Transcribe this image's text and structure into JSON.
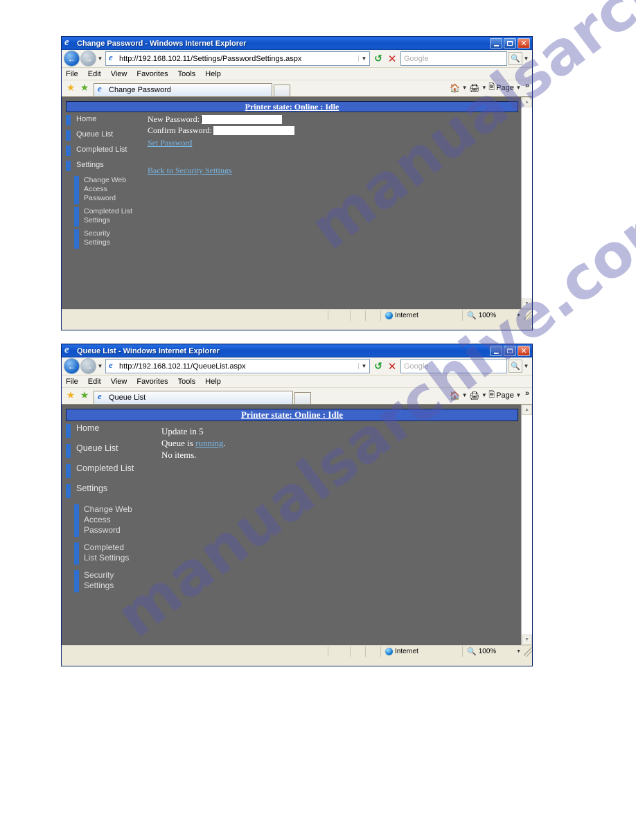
{
  "watermark": {
    "line1": "manualsarchive.com",
    "line2": "manualsarchive.com",
    "color": "#5656aa"
  },
  "windows": [
    {
      "id": "password",
      "titlebar": {
        "title": "Change Password - Windows Internet Explorer",
        "minimize_label": "Minimize",
        "maximize_label": "Maximize",
        "close_label": "Close"
      },
      "navbar": {
        "back_label": "Back",
        "forward_label": "Forward",
        "history_caret": "▼",
        "url": "http://192.168.102.11/Settings/PasswordSettings.aspx",
        "url_caret": "▼",
        "refresh_label": "Refresh",
        "stop_label": "Stop",
        "search_placeholder": "Google",
        "search_value": "",
        "search_go_label": "Search",
        "search_caret": "▼"
      },
      "menubar": [
        "File",
        "Edit",
        "View",
        "Favorites",
        "Tools",
        "Help"
      ],
      "tabbar": {
        "favorites_star": "★",
        "add_favorites_star": "★",
        "tab_label": "Change Password",
        "new_tab_label": "New Tab",
        "home_label": "Home",
        "print_label": "Print",
        "page_label": "Page",
        "page_caret": "▼",
        "overflow": "»"
      },
      "page": {
        "printer_state": "Printer state: Online : Idle",
        "nav_main": [
          "Home",
          "Queue List",
          "Completed List",
          "Settings"
        ],
        "nav_sub": [
          "Change Web Access Password",
          "Completed List Settings",
          "Security Settings"
        ],
        "form": {
          "new_password_label": "New Password:",
          "new_password_value": "",
          "confirm_password_label": "Confirm Password:",
          "confirm_password_value": "",
          "set_password_link": "Set Password",
          "back_link": "Back to Security Settings"
        }
      },
      "statusbar": {
        "zone": "Internet",
        "zoom": "100%",
        "zoom_caret": "▼"
      }
    },
    {
      "id": "queue",
      "titlebar": {
        "title": "Queue List - Windows Internet Explorer",
        "minimize_label": "Minimize",
        "maximize_label": "Maximize",
        "close_label": "Close"
      },
      "navbar": {
        "back_label": "Back",
        "forward_label": "Forward",
        "history_caret": "▼",
        "url": "http://192.168.102.11/QueueList.aspx",
        "url_caret": "▼",
        "refresh_label": "Refresh",
        "stop_label": "Stop",
        "search_placeholder": "Google",
        "search_value": "",
        "search_go_label": "Search",
        "search_caret": "▼"
      },
      "menubar": [
        "File",
        "Edit",
        "View",
        "Favorites",
        "Tools",
        "Help"
      ],
      "tabbar": {
        "favorites_star": "★",
        "add_favorites_star": "★",
        "tab_label": "Queue List",
        "new_tab_label": "New Tab",
        "home_label": "Home",
        "print_label": "Print",
        "page_label": "Page",
        "page_caret": "▼",
        "overflow": "»"
      },
      "page": {
        "printer_state": "Printer state: Online : Idle",
        "nav_main": [
          "Home",
          "Queue List",
          "Completed List",
          "Settings"
        ],
        "nav_sub": [
          "Change Web Access Password",
          "Completed List Settings",
          "Security Settings"
        ],
        "queue": {
          "update_line": "Update in 5",
          "queue_prefix": "Queue is ",
          "queue_link": "running",
          "queue_suffix": ".",
          "items_line": "No items."
        }
      },
      "statusbar": {
        "zone": "Internet",
        "zoom": "100%",
        "zoom_caret": "▼"
      }
    }
  ]
}
